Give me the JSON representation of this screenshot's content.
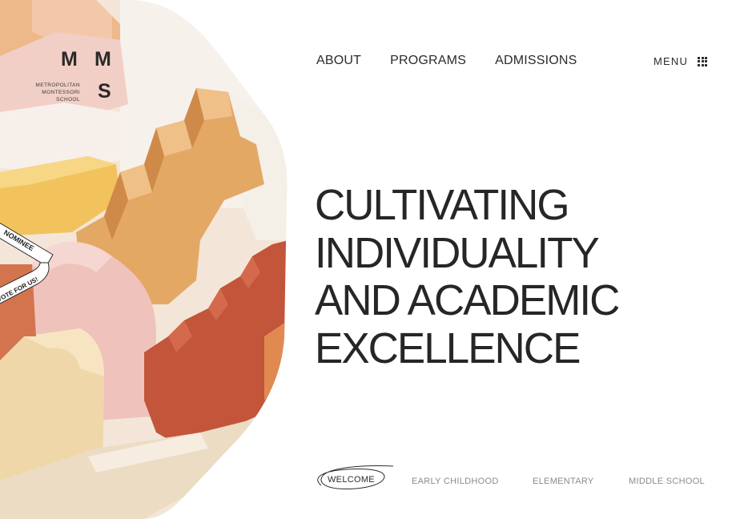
{
  "brand": {
    "logo_letters": {
      "m1": "M",
      "m2": "M",
      "s": "S"
    },
    "logo_lines": [
      "METROPOLITAN",
      "MONTESSORI",
      "SCHOOL"
    ]
  },
  "ribbon": {
    "line1": "NOMINEE",
    "line2": "VOTE FOR US!"
  },
  "nav": {
    "items": [
      {
        "label": "ABOUT"
      },
      {
        "label": "PROGRAMS"
      },
      {
        "label": "ADMISSIONS"
      }
    ],
    "menu_label": "MENU"
  },
  "hero": {
    "headline_lines": [
      "CULTIVATING",
      "INDIVIDUALITY",
      "AND ACADEMIC",
      "EXCELLENCE"
    ]
  },
  "tabs": {
    "items": [
      {
        "label": "WELCOME",
        "active": true
      },
      {
        "label": "EARLY CHILDHOOD",
        "active": false
      },
      {
        "label": "ELEMENTARY",
        "active": false
      },
      {
        "label": "MIDDLE SCHOOL",
        "active": false
      }
    ]
  },
  "icons": {
    "menu": "grid-dots-icon"
  },
  "colors": {
    "text": "#2b2b2b",
    "muted": "#8a8a8a",
    "peach": "#e7b384",
    "yellow": "#f2c15c",
    "pink": "#f1c9c4",
    "terracotta": "#c8583a",
    "cream": "#f1dfb8",
    "orange": "#e89a4a"
  }
}
